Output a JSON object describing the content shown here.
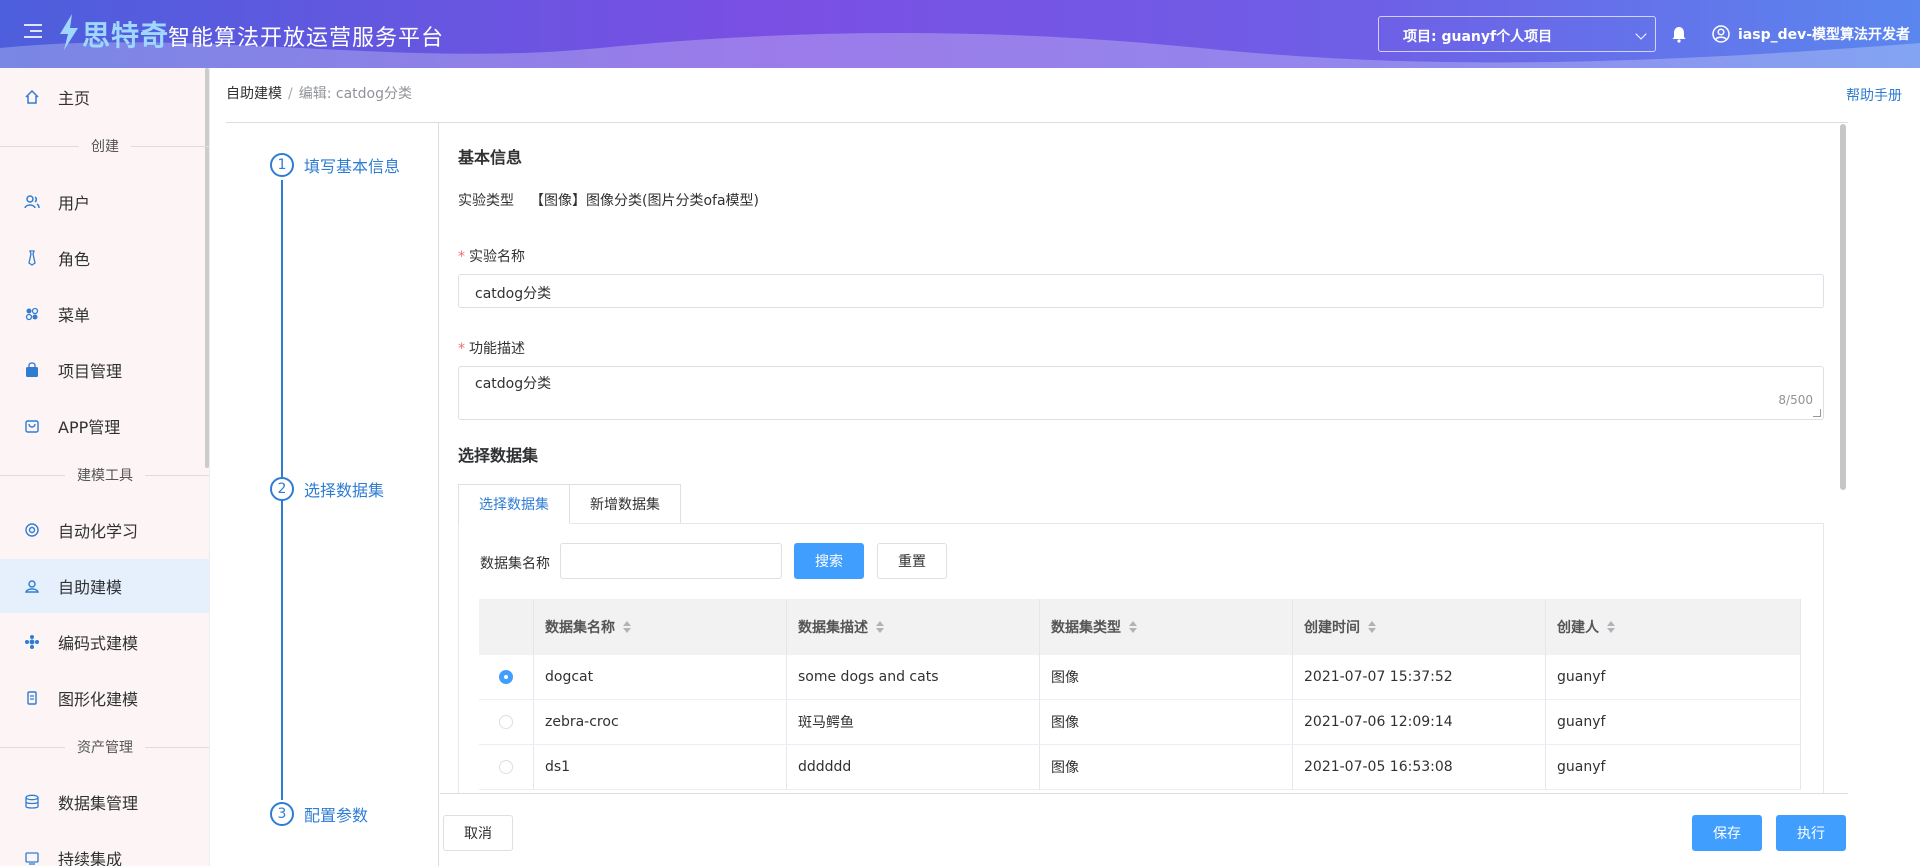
{
  "header": {
    "logo_text": "思特奇",
    "platform_title": "智能算法开放运营服务平台",
    "project_select_value": "项目: guanyf个人项目",
    "user_name": "iasp_dev-模型算法开发者"
  },
  "sidebar": {
    "items": [
      {
        "label": "主页",
        "icon": "home-icon"
      },
      {
        "section": "创建"
      },
      {
        "label": "用户",
        "icon": "users-icon"
      },
      {
        "label": "角色",
        "icon": "tie-icon"
      },
      {
        "label": "菜单",
        "icon": "grid-icon"
      },
      {
        "label": "项目管理",
        "icon": "bag-icon"
      },
      {
        "label": "APP管理",
        "icon": "shopping-bag-icon"
      },
      {
        "section": "建模工具"
      },
      {
        "label": "自动化学习",
        "icon": "cycle-icon"
      },
      {
        "label": "自助建模",
        "icon": "user-model-icon",
        "active": true
      },
      {
        "label": "编码式建模",
        "icon": "code-icon"
      },
      {
        "label": "图形化建模",
        "icon": "doc-icon"
      },
      {
        "section": "资产管理"
      },
      {
        "label": "数据集管理",
        "icon": "database-icon"
      },
      {
        "label": "持续集成",
        "icon": "ci-icon"
      }
    ]
  },
  "breadcrumb": {
    "root": "自助建模",
    "separator": "/",
    "current": "编辑: catdog分类"
  },
  "help_link": "帮助手册",
  "steps": [
    {
      "num": "1",
      "label": "填写基本信息"
    },
    {
      "num": "2",
      "label": "选择数据集"
    },
    {
      "num": "3",
      "label": "配置参数"
    }
  ],
  "basic_info": {
    "title": "基本信息",
    "exp_type_label": "实验类型",
    "exp_type_value": "【图像】图像分类(图片分类ofa模型)",
    "required_mark": "*",
    "name_label": "实验名称",
    "name_value": "catdog分类",
    "desc_label": "功能描述",
    "desc_value": "catdog分类",
    "desc_count": "8/500"
  },
  "dataset": {
    "title": "选择数据集",
    "tabs": [
      "选择数据集",
      "新增数据集"
    ],
    "search_label": "数据集名称",
    "search_value": "",
    "search_button": "搜索",
    "reset_button": "重置",
    "columns": [
      "数据集名称",
      "数据集描述",
      "数据集类型",
      "创建时间",
      "创建人"
    ],
    "rows": [
      {
        "selected": true,
        "name": "dogcat",
        "desc": "some dogs and cats",
        "type": "图像",
        "time": "2021-07-07 15:37:52",
        "creator": "guanyf"
      },
      {
        "selected": false,
        "name": "zebra-croc",
        "desc": "斑马鳄鱼",
        "type": "图像",
        "time": "2021-07-06 12:09:14",
        "creator": "guanyf"
      },
      {
        "selected": false,
        "name": "ds1",
        "desc": "dddddd",
        "type": "图像",
        "time": "2021-07-05 16:53:08",
        "creator": "guanyf"
      }
    ]
  },
  "footer": {
    "cancel": "取消",
    "save": "保存",
    "execute": "执行"
  },
  "colors": {
    "primary": "#409eff",
    "accent": "#2f7cd3",
    "header_gradient_start": "#4d5fdc",
    "header_gradient_end": "#5a86ee",
    "sidebar_bg": "#fdf5f5",
    "active_item_bg": "#e6f0fd"
  }
}
